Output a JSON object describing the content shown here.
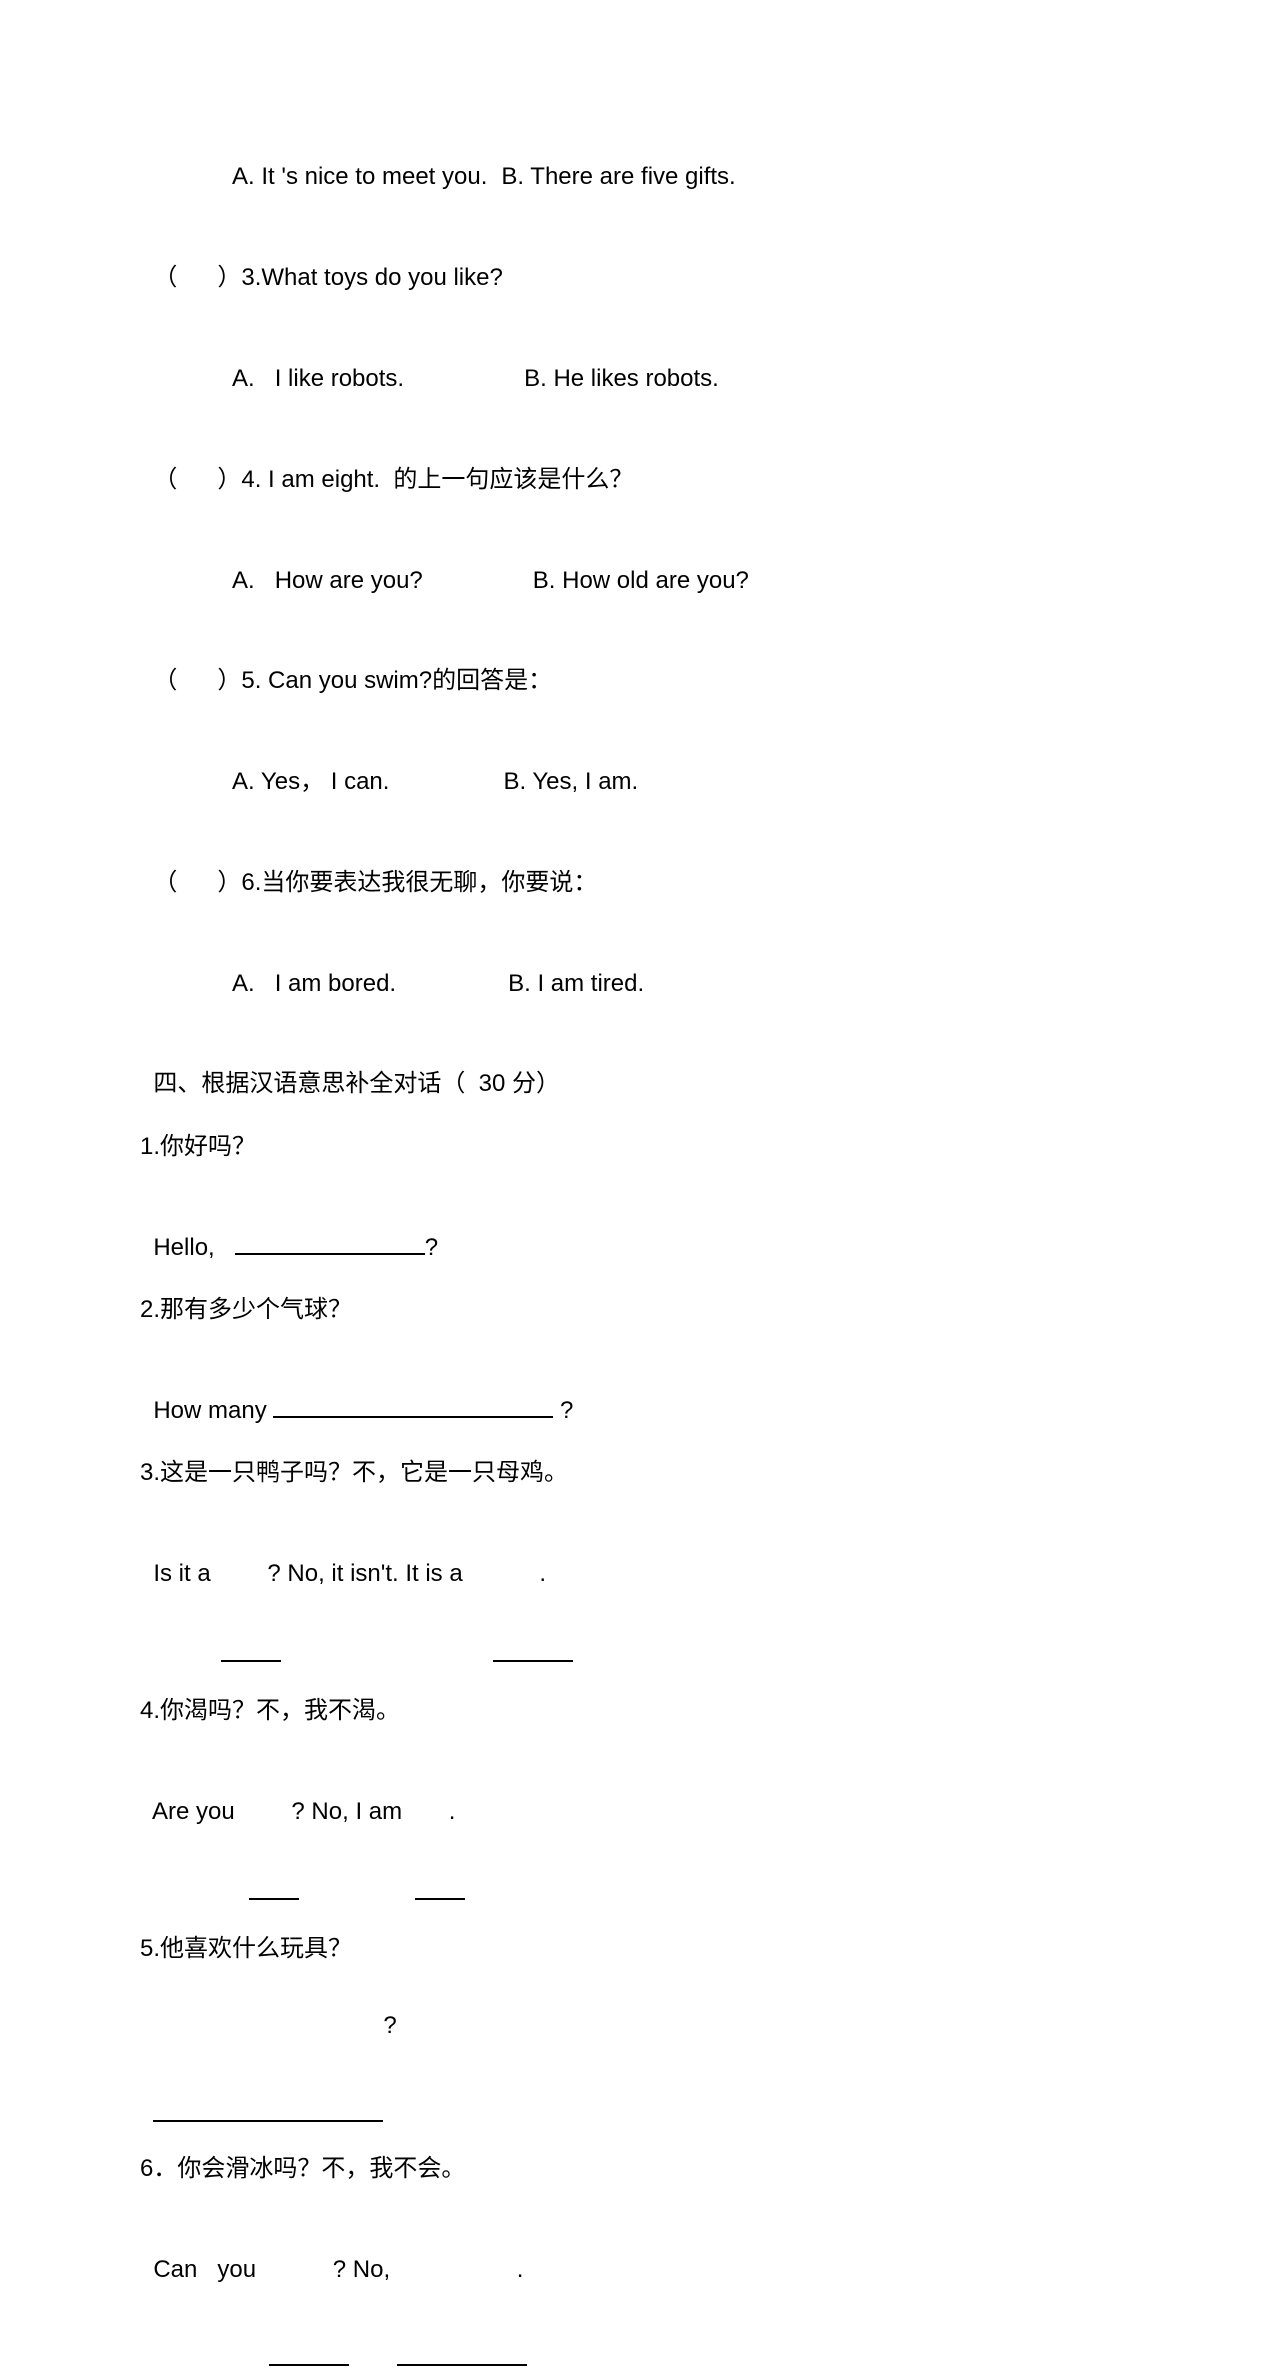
{
  "section3": {
    "q_prev_options": {
      "a": "A. It 's nice to meet you.",
      "b": "B. There are five gifts."
    },
    "q3": {
      "paren": "（      ）",
      "prompt": "3.What toys do you like?",
      "a": "A.   I like robots.",
      "b": "B. He likes robots."
    },
    "q4": {
      "paren": "（      ）",
      "prompt": "4. I am eight.  的上一句应该是什么？",
      "a": "A.   How are you?",
      "b": "B. How old are you?"
    },
    "q5": {
      "paren": "（      ）",
      "prompt": "5. Can you swim?的回答是：",
      "a": "A. Yes， I can.",
      "b": "B. Yes, I am."
    },
    "q6": {
      "paren": "（      ）",
      "prompt": "6.当你要表达我很无聊，你要说：",
      "a": "A.   I am bored.",
      "b": "B. I am tired."
    }
  },
  "section4": {
    "title": "四、根据汉语意思补全对话（  30 分）",
    "q1": {
      "zh": "1.你好吗？",
      "en_pre": "Hello,   ",
      "en_post": "?"
    },
    "q2": {
      "zh": "2.那有多少个气球？",
      "en_pre": "How many ",
      "en_post": " ?"
    },
    "q3": {
      "zh": "3.这是一只鸭子吗？不，它是一只母鸡。",
      "en_a": "Is it a ",
      "en_b": "? No, it isn't. It is a ",
      "en_c": "."
    },
    "q4": {
      "zh": "4.你渴吗？不，我不渴。",
      "en_a": "Are you ",
      "en_b": "? No, I am ",
      "en_c": "."
    },
    "q5": {
      "zh": "5.他喜欢什么玩具？",
      "qmark": "?"
    },
    "q6": {
      "zh": "6．你会滑冰吗？不，我不会。",
      "en_a": "Can   you ",
      "en_b": "? No, ",
      "en_c": "."
    }
  }
}
